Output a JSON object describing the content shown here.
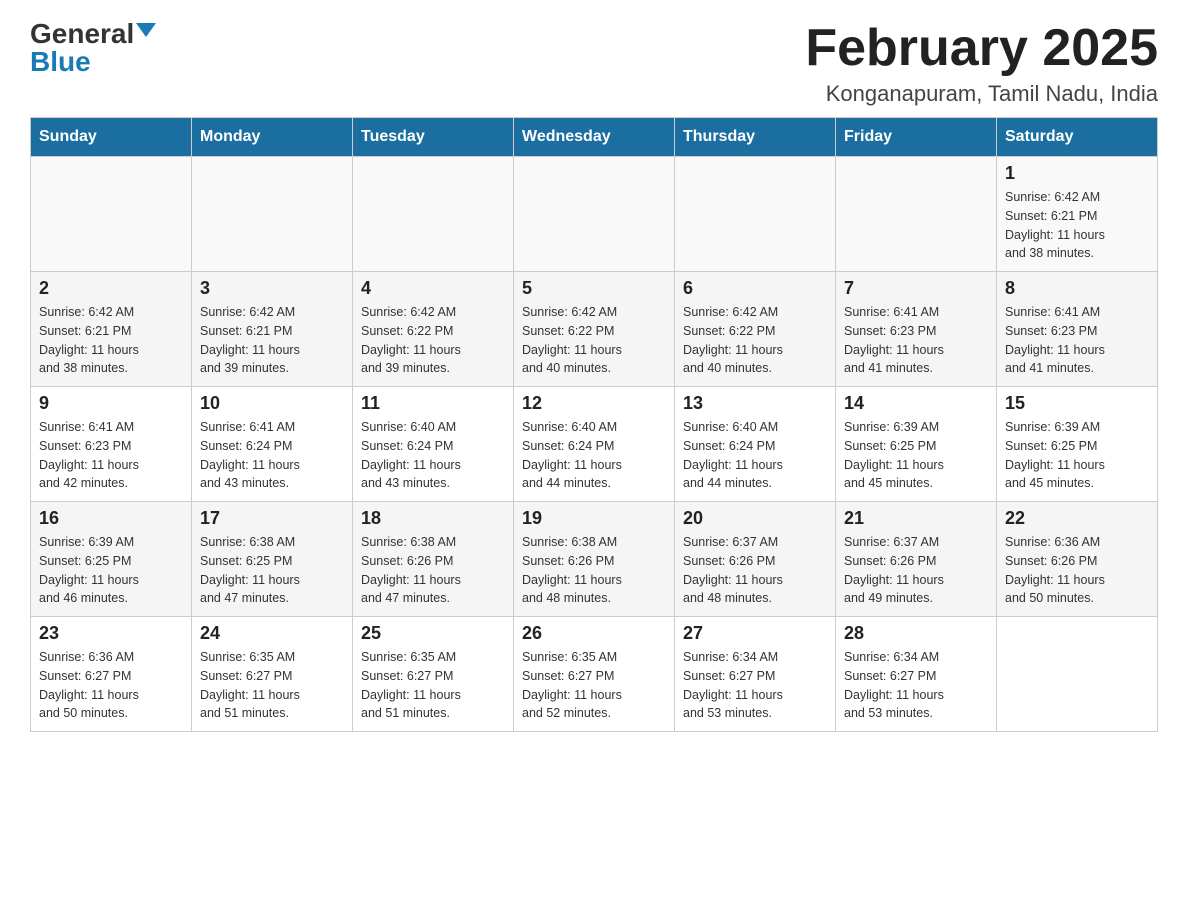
{
  "logo": {
    "general": "General",
    "blue": "Blue"
  },
  "header": {
    "title": "February 2025",
    "location": "Konganapuram, Tamil Nadu, India"
  },
  "weekdays": [
    "Sunday",
    "Monday",
    "Tuesday",
    "Wednesday",
    "Thursday",
    "Friday",
    "Saturday"
  ],
  "weeks": [
    [
      {
        "day": "",
        "info": ""
      },
      {
        "day": "",
        "info": ""
      },
      {
        "day": "",
        "info": ""
      },
      {
        "day": "",
        "info": ""
      },
      {
        "day": "",
        "info": ""
      },
      {
        "day": "",
        "info": ""
      },
      {
        "day": "1",
        "info": "Sunrise: 6:42 AM\nSunset: 6:21 PM\nDaylight: 11 hours\nand 38 minutes."
      }
    ],
    [
      {
        "day": "2",
        "info": "Sunrise: 6:42 AM\nSunset: 6:21 PM\nDaylight: 11 hours\nand 38 minutes."
      },
      {
        "day": "3",
        "info": "Sunrise: 6:42 AM\nSunset: 6:21 PM\nDaylight: 11 hours\nand 39 minutes."
      },
      {
        "day": "4",
        "info": "Sunrise: 6:42 AM\nSunset: 6:22 PM\nDaylight: 11 hours\nand 39 minutes."
      },
      {
        "day": "5",
        "info": "Sunrise: 6:42 AM\nSunset: 6:22 PM\nDaylight: 11 hours\nand 40 minutes."
      },
      {
        "day": "6",
        "info": "Sunrise: 6:42 AM\nSunset: 6:22 PM\nDaylight: 11 hours\nand 40 minutes."
      },
      {
        "day": "7",
        "info": "Sunrise: 6:41 AM\nSunset: 6:23 PM\nDaylight: 11 hours\nand 41 minutes."
      },
      {
        "day": "8",
        "info": "Sunrise: 6:41 AM\nSunset: 6:23 PM\nDaylight: 11 hours\nand 41 minutes."
      }
    ],
    [
      {
        "day": "9",
        "info": "Sunrise: 6:41 AM\nSunset: 6:23 PM\nDaylight: 11 hours\nand 42 minutes."
      },
      {
        "day": "10",
        "info": "Sunrise: 6:41 AM\nSunset: 6:24 PM\nDaylight: 11 hours\nand 43 minutes."
      },
      {
        "day": "11",
        "info": "Sunrise: 6:40 AM\nSunset: 6:24 PM\nDaylight: 11 hours\nand 43 minutes."
      },
      {
        "day": "12",
        "info": "Sunrise: 6:40 AM\nSunset: 6:24 PM\nDaylight: 11 hours\nand 44 minutes."
      },
      {
        "day": "13",
        "info": "Sunrise: 6:40 AM\nSunset: 6:24 PM\nDaylight: 11 hours\nand 44 minutes."
      },
      {
        "day": "14",
        "info": "Sunrise: 6:39 AM\nSunset: 6:25 PM\nDaylight: 11 hours\nand 45 minutes."
      },
      {
        "day": "15",
        "info": "Sunrise: 6:39 AM\nSunset: 6:25 PM\nDaylight: 11 hours\nand 45 minutes."
      }
    ],
    [
      {
        "day": "16",
        "info": "Sunrise: 6:39 AM\nSunset: 6:25 PM\nDaylight: 11 hours\nand 46 minutes."
      },
      {
        "day": "17",
        "info": "Sunrise: 6:38 AM\nSunset: 6:25 PM\nDaylight: 11 hours\nand 47 minutes."
      },
      {
        "day": "18",
        "info": "Sunrise: 6:38 AM\nSunset: 6:26 PM\nDaylight: 11 hours\nand 47 minutes."
      },
      {
        "day": "19",
        "info": "Sunrise: 6:38 AM\nSunset: 6:26 PM\nDaylight: 11 hours\nand 48 minutes."
      },
      {
        "day": "20",
        "info": "Sunrise: 6:37 AM\nSunset: 6:26 PM\nDaylight: 11 hours\nand 48 minutes."
      },
      {
        "day": "21",
        "info": "Sunrise: 6:37 AM\nSunset: 6:26 PM\nDaylight: 11 hours\nand 49 minutes."
      },
      {
        "day": "22",
        "info": "Sunrise: 6:36 AM\nSunset: 6:26 PM\nDaylight: 11 hours\nand 50 minutes."
      }
    ],
    [
      {
        "day": "23",
        "info": "Sunrise: 6:36 AM\nSunset: 6:27 PM\nDaylight: 11 hours\nand 50 minutes."
      },
      {
        "day": "24",
        "info": "Sunrise: 6:35 AM\nSunset: 6:27 PM\nDaylight: 11 hours\nand 51 minutes."
      },
      {
        "day": "25",
        "info": "Sunrise: 6:35 AM\nSunset: 6:27 PM\nDaylight: 11 hours\nand 51 minutes."
      },
      {
        "day": "26",
        "info": "Sunrise: 6:35 AM\nSunset: 6:27 PM\nDaylight: 11 hours\nand 52 minutes."
      },
      {
        "day": "27",
        "info": "Sunrise: 6:34 AM\nSunset: 6:27 PM\nDaylight: 11 hours\nand 53 minutes."
      },
      {
        "day": "28",
        "info": "Sunrise: 6:34 AM\nSunset: 6:27 PM\nDaylight: 11 hours\nand 53 minutes."
      },
      {
        "day": "",
        "info": ""
      }
    ]
  ]
}
